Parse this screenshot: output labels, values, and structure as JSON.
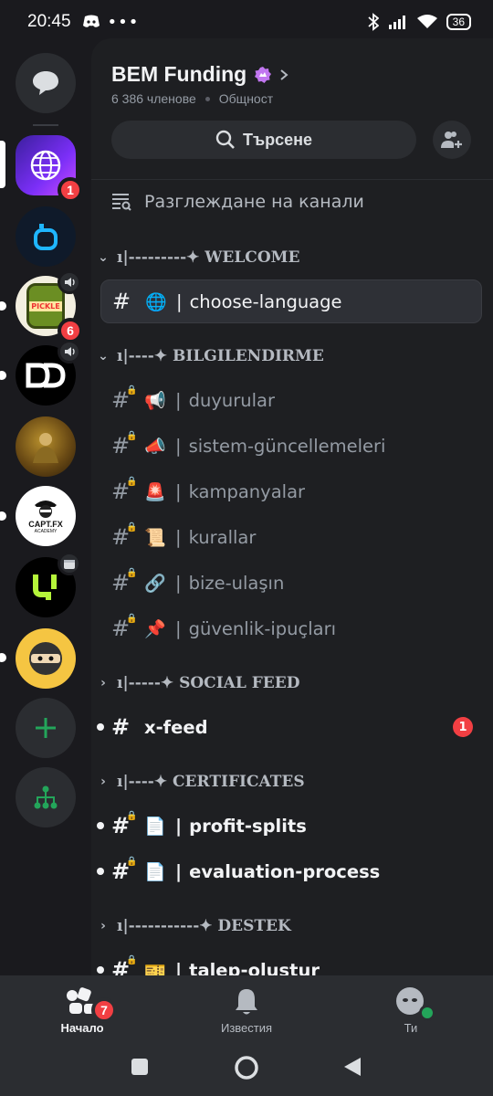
{
  "status": {
    "time": "20:45",
    "battery": "36"
  },
  "server_rail": {
    "servers": [
      {
        "name": "dm-home",
        "badge": ""
      },
      {
        "name": "globe-server",
        "badge": "1"
      },
      {
        "name": "blue-server",
        "badge": ""
      },
      {
        "name": "pickle-server",
        "badge": "6"
      },
      {
        "name": "dd-server",
        "badge": ""
      },
      {
        "name": "painting-server",
        "badge": ""
      },
      {
        "name": "captfx-server",
        "badge": ""
      },
      {
        "name": "green-server",
        "badge": ""
      },
      {
        "name": "ninja-server",
        "badge": ""
      }
    ],
    "captfx_label": "CAPT.FX",
    "captfx_sub": "ACADEMY",
    "pickle_label": "PICKLE"
  },
  "guild": {
    "name": "BEM Funding",
    "members": "6 386 членове",
    "type": "Общност",
    "search_label": "Търсене",
    "browse_label": "Разглеждане на канали"
  },
  "categories": {
    "welcome": "ı|---------✦ WELCOME",
    "bilgi": "ı|----✦ BILGILENDIRME",
    "social": "ı|-----✦ SOCIAL FEED",
    "certs": "ı|----✦ CERTIFICATES",
    "destek": "ı|-----------✦ DESTEK"
  },
  "channels": {
    "choose_language": {
      "emoji": "🌐",
      "name": "choose-language"
    },
    "duyurular": {
      "emoji": "📢",
      "name": "duyurular"
    },
    "sistem": {
      "emoji": "📣",
      "name": "sistem-güncellemeleri"
    },
    "kampanyalar": {
      "emoji": "🚨",
      "name": "kampanyalar"
    },
    "kurallar": {
      "emoji": "📜",
      "name": "kurallar"
    },
    "bize": {
      "emoji": "🔗",
      "name": "bize-ulaşın"
    },
    "guvenlik": {
      "emoji": "📌",
      "name": "güvenlik-ipuçları"
    },
    "xfeed": {
      "name": "x-feed",
      "badge": "1"
    },
    "profit": {
      "emoji": "📄",
      "name": "profit-splits"
    },
    "evaluation": {
      "emoji": "📄",
      "name": "evaluation-process"
    },
    "talep": {
      "emoji": "🎫",
      "name": "talep-oluştur"
    }
  },
  "bar_char": "|",
  "bottom_nav": {
    "home": "Начало",
    "home_badge": "7",
    "notifications": "Известия",
    "you": "Ти"
  },
  "colors": {
    "accent_red": "#f23f43",
    "panel": "#1e1f22",
    "rail": "#1a1a1e",
    "online": "#23a55a"
  }
}
